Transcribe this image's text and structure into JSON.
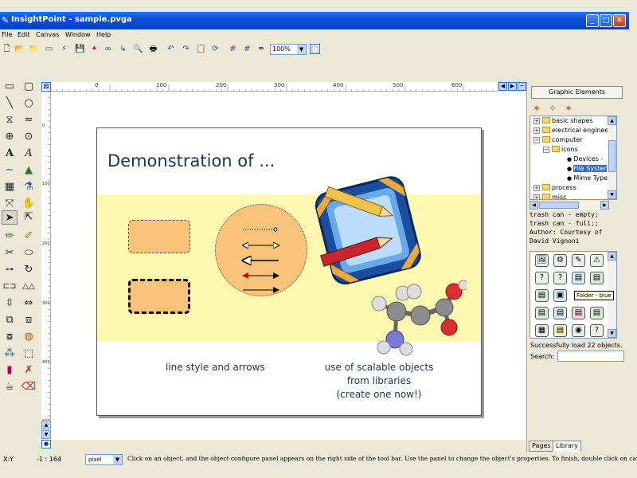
{
  "window": {
    "title": "InsightPoint - sample.pvga",
    "minimize": "_",
    "maximize": "□",
    "close": "✕"
  },
  "menu": [
    "File",
    "Edit",
    "Canvas",
    "Window",
    "Help"
  ],
  "toolbar": {
    "zoom_value": "100%"
  },
  "ruler": {
    "h_ticks": [
      "0",
      "100",
      "200",
      "300",
      "400",
      "500",
      "600"
    ],
    "v_ticks": [
      "0",
      "100",
      "200",
      "300",
      "400",
      "500"
    ]
  },
  "canvas": {
    "title": "Demonstration of ...",
    "caption_left": "line style and arrows",
    "caption_right_1": "use of scalable objects",
    "caption_right_2": "from libraries",
    "caption_right_3": "(create one now!)"
  },
  "panel": {
    "title": "Graphic Elements",
    "tree": [
      {
        "label": "basic shapes",
        "kind": "folder",
        "state": "+"
      },
      {
        "label": "electrical engineeri",
        "kind": "folder",
        "state": "+"
      },
      {
        "label": "computer",
        "kind": "folder",
        "state": "-"
      },
      {
        "label": "icons",
        "kind": "folder",
        "state": "-"
      },
      {
        "label": "Devices -",
        "kind": "leaf"
      },
      {
        "label": "File Syster",
        "kind": "leaf",
        "selected": true
      },
      {
        "label": "Mime Type",
        "kind": "leaf"
      },
      {
        "label": "process",
        "kind": "folder",
        "state": "+"
      },
      {
        "label": "misc",
        "kind": "folder",
        "state": "+"
      }
    ],
    "description_lines": [
      "trash can - empty;",
      "trash can - full;;",
      "Author: Courtesy of",
      "David Vignoni"
    ],
    "tooltip": "Folder - blue",
    "status": "Successfully load 22 objects.",
    "search_label": "Search:",
    "search_value": "",
    "tabs": [
      "Pages",
      "Library"
    ]
  },
  "statusbar": {
    "coord_label": "X:Y",
    "coord_value": "-1 : 164",
    "unit": "pixel",
    "message": "Click on an object, and the object configure panel appears on the right side of the tool bar. Use the panel to change the object's properties. To finish, double click on canvas. ..."
  }
}
